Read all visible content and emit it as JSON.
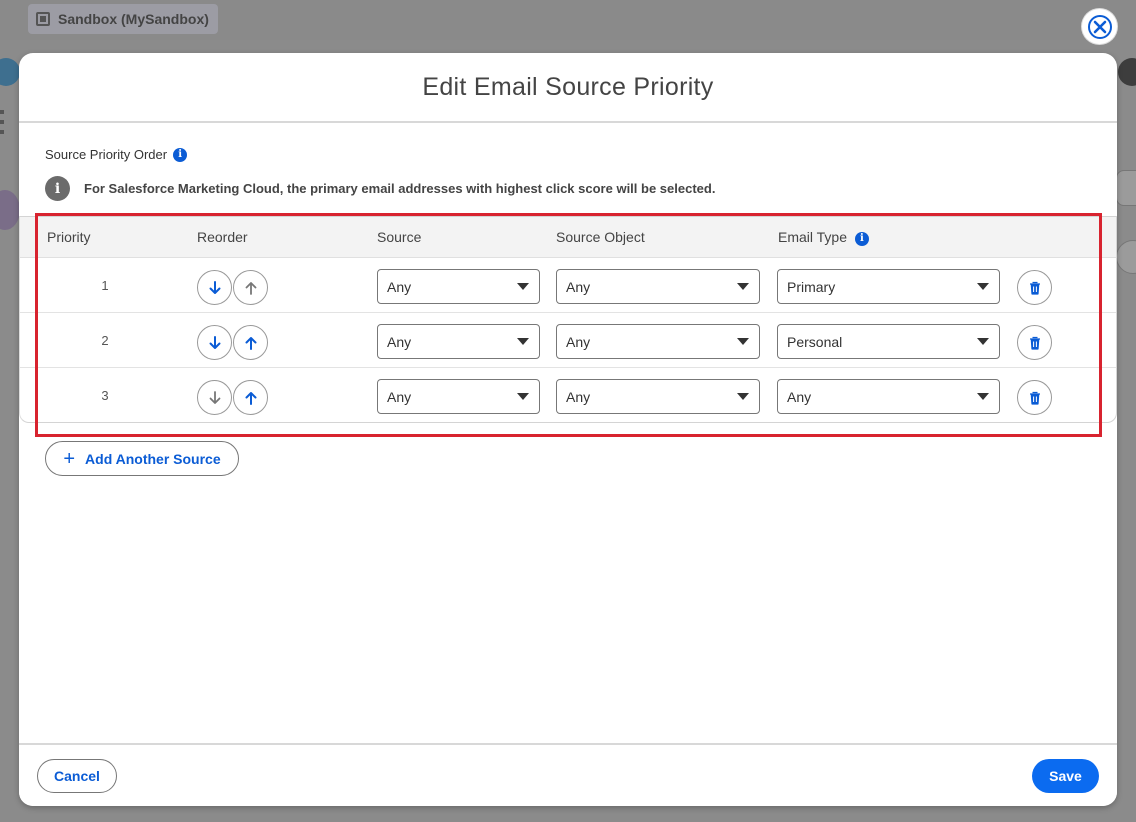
{
  "background": {
    "org_chip": "Sandbox (MySandbox)"
  },
  "modal": {
    "title": "Edit Email Source Priority",
    "section_label": "Source Priority Order",
    "notice": "For Salesforce Marketing Cloud, the primary email addresses with highest click score will be selected.",
    "columns": {
      "priority": "Priority",
      "reorder": "Reorder",
      "source": "Source",
      "source_object": "Source Object",
      "email_type": "Email Type"
    },
    "rows": [
      {
        "priority": "1",
        "source": "Any",
        "source_object": "Any",
        "email_type": "Primary",
        "down_enabled": true,
        "up_enabled": false
      },
      {
        "priority": "2",
        "source": "Any",
        "source_object": "Any",
        "email_type": "Personal",
        "down_enabled": true,
        "up_enabled": true
      },
      {
        "priority": "3",
        "source": "Any",
        "source_object": "Any",
        "email_type": "Any",
        "down_enabled": false,
        "up_enabled": true
      }
    ],
    "add_button": "Add Another Source",
    "cancel_button": "Cancel",
    "save_button": "Save"
  },
  "colors": {
    "brand_blue": "#0b5cd5",
    "save_blue": "#0b6bf0",
    "highlight_red": "#d8232f",
    "disabled_gray": "#777777"
  }
}
